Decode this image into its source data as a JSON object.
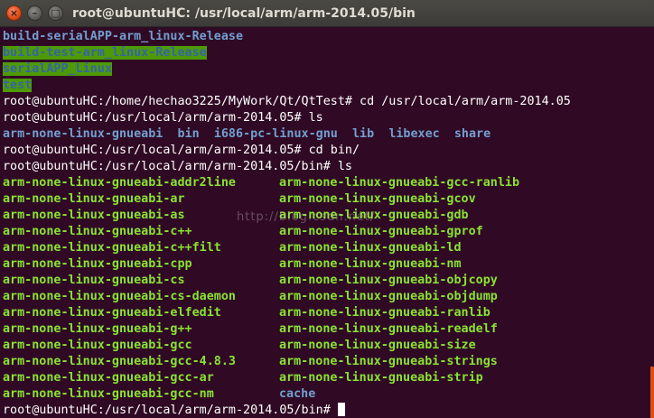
{
  "window": {
    "title": "root@ubuntuHC: /usr/local/arm/arm-2014.05/bin",
    "close_glyph": "×",
    "min_glyph": "–",
    "max_glyph": "□"
  },
  "terminal": {
    "line_build_serial": "build-serialAPP-arm_linux-Release",
    "line_build_test": "build-test-arm_linux-Release",
    "line_serialapp": "serialAPP_Linux",
    "line_test": "test",
    "cmd1": "root@ubuntuHC:/home/hechao3225/MyWork/Qt/QtTest# cd /usr/local/arm/arm-2014.05",
    "cmd2": "root@ubuntuHC:/usr/local/arm/arm-2014.05# ls",
    "ls_dirs": [
      "arm-none-linux-gnueabi",
      "bin",
      "i686-pc-linux-gnu",
      "lib",
      "libexec",
      "share"
    ],
    "cmd3": "root@ubuntuHC:/usr/local/arm/arm-2014.05# cd bin/",
    "cmd4": "root@ubuntuHC:/usr/local/arm/arm-2014.05/bin# ls",
    "bin_rows": [
      [
        "arm-none-linux-gnueabi-addr2line",
        "arm-none-linux-gnueabi-gcc-ranlib"
      ],
      [
        "arm-none-linux-gnueabi-ar",
        "arm-none-linux-gnueabi-gcov"
      ],
      [
        "arm-none-linux-gnueabi-as",
        "arm-none-linux-gnueabi-gdb"
      ],
      [
        "arm-none-linux-gnueabi-c++",
        "arm-none-linux-gnueabi-gprof"
      ],
      [
        "arm-none-linux-gnueabi-c++filt",
        "arm-none-linux-gnueabi-ld"
      ],
      [
        "arm-none-linux-gnueabi-cpp",
        "arm-none-linux-gnueabi-nm"
      ],
      [
        "arm-none-linux-gnueabi-cs",
        "arm-none-linux-gnueabi-objcopy"
      ],
      [
        "arm-none-linux-gnueabi-cs-daemon",
        "arm-none-linux-gnueabi-objdump"
      ],
      [
        "arm-none-linux-gnueabi-elfedit",
        "arm-none-linux-gnueabi-ranlib"
      ],
      [
        "arm-none-linux-gnueabi-g++",
        "arm-none-linux-gnueabi-readelf"
      ],
      [
        "arm-none-linux-gnueabi-gcc",
        "arm-none-linux-gnueabi-size"
      ],
      [
        "arm-none-linux-gnueabi-gcc-4.8.3",
        "arm-none-linux-gnueabi-strings"
      ],
      [
        "arm-none-linux-gnueabi-gcc-ar",
        "arm-none-linux-gnueabi-strip"
      ],
      [
        "arm-none-linux-gnueabi-gcc-nm",
        "cache"
      ]
    ],
    "prompt_final": "root@ubuntuHC:/usr/local/arm/arm-2014.05/bin# "
  },
  "watermark": "http://blog.csdn.net/",
  "colors": {
    "background": "#300a24",
    "directory": "#729fcf",
    "executable": "#8ae234",
    "highlight_bg": "#4e9a06",
    "close_button": "#df4b16"
  }
}
